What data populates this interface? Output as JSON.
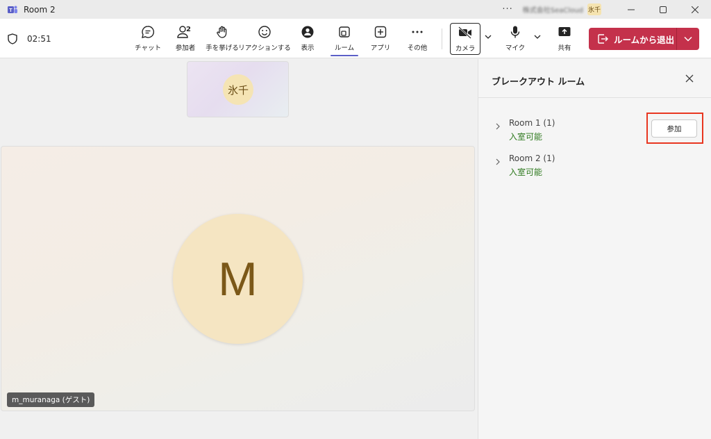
{
  "window": {
    "title": "Room 2",
    "more": "···",
    "org_name": "株式会社SeaCloud",
    "avatar_initials": "氷千"
  },
  "toolbar": {
    "timer": "02:51",
    "chat": "チャット",
    "participants": "参加者",
    "participants_count": "2",
    "raise_hand": "手を挙げる",
    "reactions": "リアクションする",
    "view": "表示",
    "rooms": "ルーム",
    "apps": "アプリ",
    "more": "その他",
    "camera": "カメラ",
    "mic": "マイク",
    "share": "共有",
    "leave": "ルームから退出"
  },
  "stage": {
    "small_tile_initials": "氷千",
    "main_avatar_initial": "M",
    "main_name": "m_muranaga (ゲスト)"
  },
  "panel": {
    "title": "ブレークアウト ルーム",
    "rooms": [
      {
        "name": "Room 1  (1)",
        "status": "入室可能"
      },
      {
        "name": "Room 2  (1)",
        "status": "入室可能"
      }
    ],
    "join_label": "参加"
  },
  "colors": {
    "accent": "#5b5fc7",
    "leave": "#c4314b",
    "status_green": "#2f7a1f",
    "highlight": "#e83620"
  }
}
